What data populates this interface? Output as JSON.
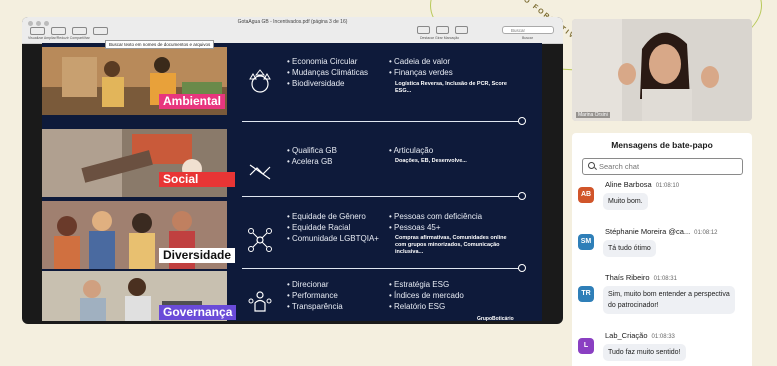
{
  "background_arc_text": "CICLO FORMATIVO",
  "pdf_window": {
    "title": "GotaAgua GB - Incentivados.pdf (página 3 de 16)",
    "toolbar_left_labels": "Visualizar  Ampliar/Reduzir  Compartilhar",
    "toolbar_right_labels": "Destacar   Girar   Marcação",
    "search_placeholder": "Buscar",
    "search_label": "Buscar",
    "tooltip": "Buscar texto em nomes de documentos e arquivos"
  },
  "slide": {
    "rows": [
      {
        "label": "Ambiental",
        "label_color": "#e8367e",
        "icon": "leaf-globe-icon",
        "col1": [
          "Economia Circular",
          "Mudanças Climáticas",
          "Biodiversidade"
        ],
        "col2": [
          "Cadeia de valor",
          "Finanças verdes"
        ],
        "col2_note": "Logística Reversa, Inclusão de PCR, Score ESG..."
      },
      {
        "label": "Social",
        "label_color": "#e83535",
        "icon": "handshake-icon",
        "col1": [
          "Qualifica GB",
          "Acelera GB"
        ],
        "col2": [
          "Articulação"
        ],
        "col2_note": "Doações, EB, Desenvolve..."
      },
      {
        "label": "Diversidade",
        "label_color": "#ffffff",
        "icon": "network-people-icon",
        "col1": [
          "Equidade de Gênero",
          "Equidade Racial",
          "Comunidade LGBTQIA+"
        ],
        "col2": [
          "Pessoas com deficiência",
          "Pessoas 45+"
        ],
        "col2_note": "Compras afirmativas, Comunidades online com grupos minorizados, Comunicação inclusiva..."
      },
      {
        "label": "Governança",
        "label_color": "#6a4bd8",
        "icon": "people-group-icon",
        "col1": [
          "Direcionar",
          "Performance",
          "Transparência"
        ],
        "col2": [
          "Estratégia ESG",
          "Índices de mercado",
          "Relatório ESG"
        ],
        "col2_note": ""
      }
    ],
    "logo": "GrupoBoticário"
  },
  "video": {
    "participant_name": "Marina Orsini"
  },
  "chat": {
    "title": "Mensagens de bate-papo",
    "search_placeholder": "Search chat",
    "messages": [
      {
        "initials": "AB",
        "color": "#d1552a",
        "sender": "Aline Barbosa",
        "time": "01:08:10",
        "text": "Muito bom."
      },
      {
        "initials": "SM",
        "color": "#2f7fb8",
        "sender": "Stéphanie Moreira @ca...",
        "time": "01:08:12",
        "text": "Tá tudo ótimo"
      },
      {
        "initials": "TR",
        "color": "#2f7fb8",
        "sender": "Thaís Ribeiro",
        "time": "01:08:31",
        "text": "Sim, muito bom entender a perspectiva do patrocinador!"
      },
      {
        "initials": "L",
        "color": "#8a3fc2",
        "sender": "Lab_Criação",
        "time": "01:08:33",
        "text": "Tudo faz muito sentido!"
      }
    ]
  }
}
